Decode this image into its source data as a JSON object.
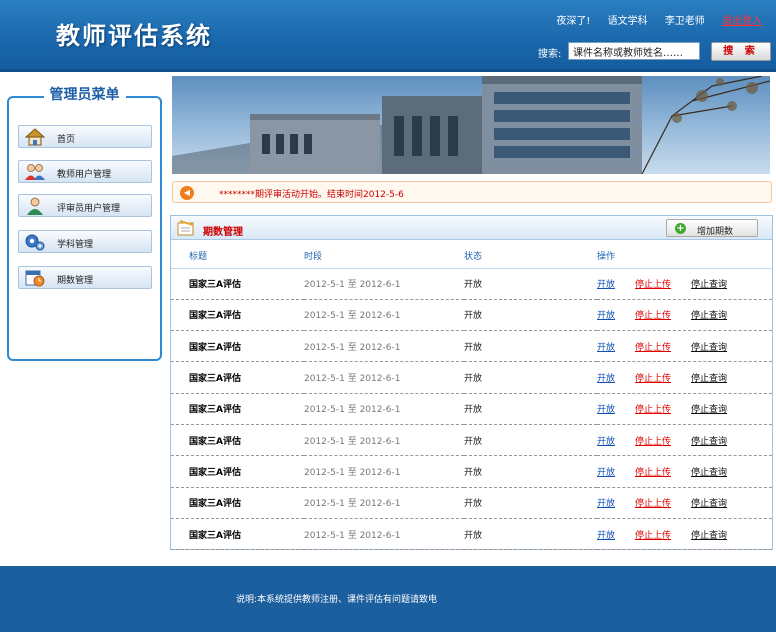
{
  "header": {
    "logo": "教师评估系统",
    "greeting": "夜深了!",
    "subject": "语文学科",
    "user": "李卫老师",
    "logout": "退出登入",
    "search_label": "搜索:",
    "search_placeholder": "课件名称或教师姓名……",
    "search_button": "搜 索"
  },
  "menu": {
    "title": "管理员菜单",
    "items": [
      {
        "label": "首页",
        "icon": "home-icon"
      },
      {
        "label": "教师用户管理",
        "icon": "teachers-icon"
      },
      {
        "label": "评审员用户管理",
        "icon": "reviewer-icon"
      },
      {
        "label": "学科管理",
        "icon": "gears-icon"
      },
      {
        "label": "期数管理",
        "icon": "calendar-clock-icon"
      }
    ]
  },
  "notice": {
    "text": "********期评审活动开始。结束时间2012-5-6",
    "icon": "speaker-icon"
  },
  "panel": {
    "title": "期数管理",
    "add_button": "增加期数",
    "columns": [
      "标题",
      "时段",
      "状态",
      "操作"
    ],
    "rows": [
      {
        "title": "国家三A评估",
        "period": "2012-5-1 至 2012-6-1",
        "status": "开放",
        "open": "开放",
        "stop_upload": "停止上传",
        "stop_query": "停止查询"
      },
      {
        "title": "国家三A评估",
        "period": "2012-5-1 至 2012-6-1",
        "status": "开放",
        "open": "开放",
        "stop_upload": "停止上传",
        "stop_query": "停止查询"
      },
      {
        "title": "国家三A评估",
        "period": "2012-5-1 至 2012-6-1",
        "status": "开放",
        "open": "开放",
        "stop_upload": "停止上传",
        "stop_query": "停止查询"
      },
      {
        "title": "国家三A评估",
        "period": "2012-5-1 至 2012-6-1",
        "status": "开放",
        "open": "开放",
        "stop_upload": "停止上传",
        "stop_query": "停止查询"
      },
      {
        "title": "国家三A评估",
        "period": "2012-5-1 至 2012-6-1",
        "status": "开放",
        "open": "开放",
        "stop_upload": "停止上传",
        "stop_query": "停止查询"
      },
      {
        "title": "国家三A评估",
        "period": "2012-5-1 至 2012-6-1",
        "status": "开放",
        "open": "开放",
        "stop_upload": "停止上传",
        "stop_query": "停止查询"
      },
      {
        "title": "国家三A评估",
        "period": "2012-5-1 至 2012-6-1",
        "status": "开放",
        "open": "开放",
        "stop_upload": "停止上传",
        "stop_query": "停止查询"
      },
      {
        "title": "国家三A评估",
        "period": "2012-5-1 至 2012-6-1",
        "status": "开放",
        "open": "开放",
        "stop_upload": "停止上传",
        "stop_query": "停止查询"
      },
      {
        "title": "国家三A评估",
        "period": "2012-5-1 至 2012-6-1",
        "status": "开放",
        "open": "开放",
        "stop_upload": "停止上传",
        "stop_query": "停止查询"
      }
    ]
  },
  "footer": {
    "text": "说明:本系统提供教师注册、课件评估有问题请致电"
  },
  "colors": {
    "header_blue": "#1b68ad",
    "link_blue": "#1050b8",
    "link_red": "#e00000",
    "footer_blue": "#1c5f9f"
  }
}
